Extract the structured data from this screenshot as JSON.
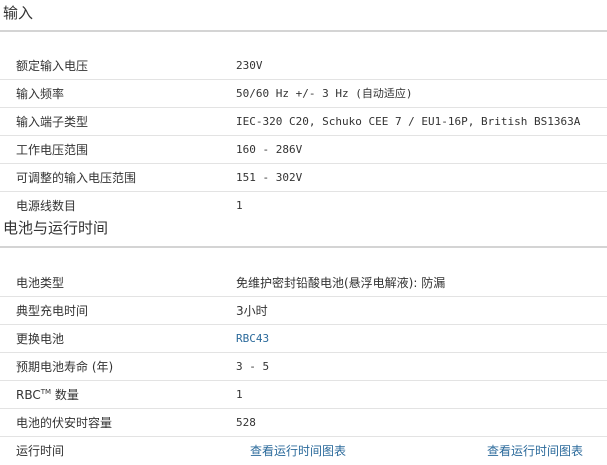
{
  "input_section": {
    "title": "输入",
    "rows": [
      {
        "label": "额定输入电压",
        "value": "230V"
      },
      {
        "label": "输入频率",
        "value": "50/60 Hz +/- 3 Hz (自动适应)"
      },
      {
        "label": "输入端子类型",
        "value": "IEC-320 C20, Schuko CEE 7 / EU1-16P, British BS1363A"
      },
      {
        "label": "工作电压范围",
        "value": "160 - 286V"
      },
      {
        "label": "可调整的输入电压范围",
        "value": "151 - 302V"
      },
      {
        "label": "电源线数目",
        "value": "1"
      }
    ]
  },
  "battery_section": {
    "title": "电池与运行时间",
    "battery_type": {
      "label": "电池类型",
      "value": "免维护密封铅酸电池(悬浮电解液): 防漏"
    },
    "charge_time": {
      "label": "典型充电时间",
      "value": "3小时"
    },
    "replacement": {
      "label": "更换电池",
      "value": "RBC43"
    },
    "life": {
      "label": "预期电池寿命 (年)",
      "value": "3 - 5"
    },
    "rbc_count": {
      "label_prefix": "RBC",
      "label_sup": "TM",
      "label_suffix": " 数量",
      "value": "1"
    },
    "va_hour": {
      "label": "电池的伏安时容量",
      "value": "528"
    },
    "runtime": {
      "label": "运行时间",
      "link_a": "查看运行时间图表",
      "link_b": "查看运行时间图表"
    }
  }
}
